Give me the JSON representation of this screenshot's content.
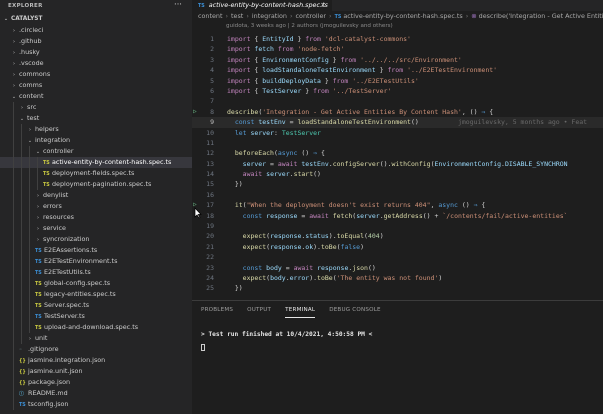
{
  "explorer": {
    "title": "EXPLORER",
    "more": "···",
    "items": [
      {
        "depth": 0,
        "chev": "⌄",
        "icon": "",
        "label": "CATALYST",
        "section": true
      },
      {
        "depth": 1,
        "chev": "›",
        "icon": "",
        "label": ".circleci"
      },
      {
        "depth": 1,
        "chev": "›",
        "icon": "",
        "label": ".github"
      },
      {
        "depth": 1,
        "chev": "›",
        "icon": "",
        "label": ".husky"
      },
      {
        "depth": 1,
        "chev": "›",
        "icon": "",
        "label": ".vscode"
      },
      {
        "depth": 1,
        "chev": "›",
        "icon": "",
        "label": "commons"
      },
      {
        "depth": 1,
        "chev": "›",
        "icon": "",
        "label": "comms"
      },
      {
        "depth": 1,
        "chev": "⌄",
        "icon": "",
        "label": "content"
      },
      {
        "depth": 2,
        "chev": "›",
        "icon": "",
        "label": "src"
      },
      {
        "depth": 2,
        "chev": "⌄",
        "icon": "",
        "label": "test"
      },
      {
        "depth": 3,
        "chev": "›",
        "icon": "",
        "label": "helpers"
      },
      {
        "depth": 3,
        "chev": "⌄",
        "icon": "",
        "label": "integration"
      },
      {
        "depth": 4,
        "chev": "⌄",
        "icon": "",
        "label": "controller"
      },
      {
        "depth": 5,
        "chev": "",
        "icon": "TS",
        "label": "active-entity-by-content-hash.spec.ts",
        "active": true,
        "kind": "ts-y"
      },
      {
        "depth": 5,
        "chev": "",
        "icon": "TS",
        "label": "deployment-fields.spec.ts",
        "kind": "ts-y"
      },
      {
        "depth": 5,
        "chev": "",
        "icon": "TS",
        "label": "deployment-pagination.spec.ts",
        "kind": "ts-y"
      },
      {
        "depth": 4,
        "chev": "›",
        "icon": "",
        "label": "denylist"
      },
      {
        "depth": 4,
        "chev": "›",
        "icon": "",
        "label": "errors"
      },
      {
        "depth": 4,
        "chev": "›",
        "icon": "",
        "label": "resources"
      },
      {
        "depth": 4,
        "chev": "›",
        "icon": "",
        "label": "service"
      },
      {
        "depth": 4,
        "chev": "›",
        "icon": "",
        "label": "syncronization"
      },
      {
        "depth": 4,
        "chev": "",
        "icon": "TS",
        "label": "E2EAssertions.ts",
        "kind": "ts"
      },
      {
        "depth": 4,
        "chev": "",
        "icon": "TS",
        "label": "E2ETestEnvironment.ts",
        "kind": "ts"
      },
      {
        "depth": 4,
        "chev": "",
        "icon": "TS",
        "label": "E2ETestUtils.ts",
        "kind": "ts"
      },
      {
        "depth": 4,
        "chev": "",
        "icon": "TS",
        "label": "global-config.spec.ts",
        "kind": "ts-y"
      },
      {
        "depth": 4,
        "chev": "",
        "icon": "TS",
        "label": "legacy-entities.spec.ts",
        "kind": "ts-y"
      },
      {
        "depth": 4,
        "chev": "",
        "icon": "TS",
        "label": "Server.spec.ts",
        "kind": "ts-y"
      },
      {
        "depth": 4,
        "chev": "",
        "icon": "TS",
        "label": "TestServer.ts",
        "kind": "ts"
      },
      {
        "depth": 4,
        "chev": "",
        "icon": "TS",
        "label": "upload-and-download.spec.ts",
        "kind": "ts-y"
      },
      {
        "depth": 3,
        "chev": "›",
        "icon": "",
        "label": "unit"
      },
      {
        "depth": 2,
        "chev": "",
        "icon": "◦",
        "label": ".gitignore",
        "kind": "ign"
      },
      {
        "depth": 2,
        "chev": "",
        "icon": "{}",
        "label": "jasmine.integration.json",
        "kind": "json"
      },
      {
        "depth": 2,
        "chev": "",
        "icon": "{}",
        "label": "jasmine.unit.json",
        "kind": "json"
      },
      {
        "depth": 2,
        "chev": "",
        "icon": "{}",
        "label": "package.json",
        "kind": "json"
      },
      {
        "depth": 2,
        "chev": "",
        "icon": "ⓘ",
        "label": "README.md",
        "kind": "md"
      },
      {
        "depth": 2,
        "chev": "",
        "icon": "TS",
        "label": "tsconfig.json",
        "kind": "ts"
      }
    ]
  },
  "tab": {
    "icon": "TS",
    "label": "active-entity-by-content-hash.spec.ts",
    "close": "×"
  },
  "breadcrumb": [
    "content",
    "test",
    "integration",
    "controller",
    "active-entity-by-content-hash.spec.ts",
    "describe('Integration - Get Active Entities B"
  ],
  "blame_header": "guidota, 3 weeks ago | 2 authors (jmoguilevsky and others)",
  "inline_blame": "jmoguilevsky, 5 months ago • Feat",
  "code": {
    "current_line": 9,
    "run_gutter_lines": [
      8,
      17
    ],
    "lines": [
      {
        "n": 1,
        "tokens": [
          [
            "kw",
            "import"
          ],
          [
            "pl",
            " { "
          ],
          [
            "var",
            "EntityId"
          ],
          [
            "pl",
            " } "
          ],
          [
            "kw",
            "from"
          ],
          [
            "pl",
            " "
          ],
          [
            "str",
            "'dcl-catalyst-commons'"
          ]
        ]
      },
      {
        "n": 2,
        "tokens": [
          [
            "kw",
            "import"
          ],
          [
            "pl",
            " "
          ],
          [
            "var",
            "fetch"
          ],
          [
            "pl",
            " "
          ],
          [
            "kw",
            "from"
          ],
          [
            "pl",
            " "
          ],
          [
            "str",
            "'node-fetch'"
          ]
        ]
      },
      {
        "n": 3,
        "tokens": [
          [
            "kw",
            "import"
          ],
          [
            "pl",
            " { "
          ],
          [
            "var",
            "EnvironmentConfig"
          ],
          [
            "pl",
            " } "
          ],
          [
            "kw",
            "from"
          ],
          [
            "pl",
            " "
          ],
          [
            "str",
            "'../../../src/Environment'"
          ]
        ]
      },
      {
        "n": 4,
        "tokens": [
          [
            "kw",
            "import"
          ],
          [
            "pl",
            " { "
          ],
          [
            "var",
            "loadStandaloneTestEnvironment"
          ],
          [
            "pl",
            " } "
          ],
          [
            "kw",
            "from"
          ],
          [
            "pl",
            " "
          ],
          [
            "str",
            "'../E2ETestEnvironment'"
          ]
        ]
      },
      {
        "n": 5,
        "tokens": [
          [
            "kw",
            "import"
          ],
          [
            "pl",
            " { "
          ],
          [
            "var",
            "buildDeployData"
          ],
          [
            "pl",
            " } "
          ],
          [
            "kw",
            "from"
          ],
          [
            "pl",
            " "
          ],
          [
            "str",
            "'../E2ETestUtils'"
          ]
        ]
      },
      {
        "n": 6,
        "tokens": [
          [
            "kw",
            "import"
          ],
          [
            "pl",
            " { "
          ],
          [
            "var",
            "TestServer"
          ],
          [
            "pl",
            " } "
          ],
          [
            "kw",
            "from"
          ],
          [
            "pl",
            " "
          ],
          [
            "str",
            "'../TestServer'"
          ]
        ]
      },
      {
        "n": 7,
        "tokens": []
      },
      {
        "n": 8,
        "tokens": [
          [
            "fn",
            "describe"
          ],
          [
            "pl",
            "("
          ],
          [
            "str",
            "'Integration - Get Active Entities By Content Hash'"
          ],
          [
            "pl",
            ", () "
          ],
          [
            "kb",
            "⇒"
          ],
          [
            "pl",
            " {"
          ]
        ]
      },
      {
        "n": 9,
        "tokens": [
          [
            "pl",
            "  "
          ],
          [
            "kb",
            "const"
          ],
          [
            "pl",
            " "
          ],
          [
            "var",
            "testEnv"
          ],
          [
            "pl",
            " = "
          ],
          [
            "fn",
            "loadStandaloneTestEnvironment"
          ],
          [
            "pl",
            "()"
          ]
        ],
        "blame": true
      },
      {
        "n": 10,
        "tokens": [
          [
            "pl",
            "  "
          ],
          [
            "kb",
            "let"
          ],
          [
            "pl",
            " "
          ],
          [
            "var",
            "server"
          ],
          [
            "pl",
            ": "
          ],
          [
            "typ",
            "TestServer"
          ]
        ]
      },
      {
        "n": 11,
        "tokens": []
      },
      {
        "n": 12,
        "tokens": [
          [
            "pl",
            "  "
          ],
          [
            "fn",
            "beforeEach"
          ],
          [
            "pl",
            "("
          ],
          [
            "kb",
            "async"
          ],
          [
            "pl",
            " () "
          ],
          [
            "kb",
            "⇒"
          ],
          [
            "pl",
            " {"
          ]
        ]
      },
      {
        "n": 13,
        "tokens": [
          [
            "pl",
            "    "
          ],
          [
            "var",
            "server"
          ],
          [
            "pl",
            " = "
          ],
          [
            "kw",
            "await"
          ],
          [
            "pl",
            " "
          ],
          [
            "var",
            "testEnv"
          ],
          [
            "pl",
            "."
          ],
          [
            "fn",
            "configServer"
          ],
          [
            "pl",
            "()."
          ],
          [
            "fn",
            "withConfig"
          ],
          [
            "pl",
            "("
          ],
          [
            "var",
            "EnvironmentConfig"
          ],
          [
            "pl",
            "."
          ],
          [
            "var",
            "DISABLE_SYNCHRON"
          ]
        ]
      },
      {
        "n": 14,
        "tokens": [
          [
            "pl",
            "    "
          ],
          [
            "kw",
            "await"
          ],
          [
            "pl",
            " "
          ],
          [
            "var",
            "server"
          ],
          [
            "pl",
            "."
          ],
          [
            "fn",
            "start"
          ],
          [
            "pl",
            "()"
          ]
        ]
      },
      {
        "n": 15,
        "tokens": [
          [
            "pl",
            "  })"
          ]
        ]
      },
      {
        "n": 16,
        "tokens": []
      },
      {
        "n": 17,
        "tokens": [
          [
            "pl",
            "  "
          ],
          [
            "fn",
            "it"
          ],
          [
            "pl",
            "("
          ],
          [
            "str",
            "\"When the deployment doesn't exist returns 404\""
          ],
          [
            "pl",
            ", "
          ],
          [
            "kb",
            "async"
          ],
          [
            "pl",
            " () "
          ],
          [
            "kb",
            "⇒"
          ],
          [
            "pl",
            " {"
          ]
        ]
      },
      {
        "n": 18,
        "tokens": [
          [
            "pl",
            "    "
          ],
          [
            "kb",
            "const"
          ],
          [
            "pl",
            " "
          ],
          [
            "var",
            "response"
          ],
          [
            "pl",
            " = "
          ],
          [
            "kw",
            "await"
          ],
          [
            "pl",
            " "
          ],
          [
            "fn",
            "fetch"
          ],
          [
            "pl",
            "("
          ],
          [
            "var",
            "server"
          ],
          [
            "pl",
            "."
          ],
          [
            "fn",
            "getAddress"
          ],
          [
            "pl",
            "() + "
          ],
          [
            "str",
            "`/contents/fail/active-entities`"
          ]
        ]
      },
      {
        "n": 19,
        "tokens": []
      },
      {
        "n": 20,
        "tokens": [
          [
            "pl",
            "    "
          ],
          [
            "fn",
            "expect"
          ],
          [
            "pl",
            "("
          ],
          [
            "var",
            "response"
          ],
          [
            "pl",
            "."
          ],
          [
            "var",
            "status"
          ],
          [
            "pl",
            ")."
          ],
          [
            "fn",
            "toEqual"
          ],
          [
            "pl",
            "("
          ],
          [
            "num",
            "404"
          ],
          [
            "pl",
            ")"
          ]
        ]
      },
      {
        "n": 21,
        "tokens": [
          [
            "pl",
            "    "
          ],
          [
            "fn",
            "expect"
          ],
          [
            "pl",
            "("
          ],
          [
            "var",
            "response"
          ],
          [
            "pl",
            "."
          ],
          [
            "var",
            "ok"
          ],
          [
            "pl",
            ")."
          ],
          [
            "fn",
            "toBe"
          ],
          [
            "pl",
            "("
          ],
          [
            "kb",
            "false"
          ],
          [
            "pl",
            ")"
          ]
        ]
      },
      {
        "n": 22,
        "tokens": []
      },
      {
        "n": 23,
        "tokens": [
          [
            "pl",
            "    "
          ],
          [
            "kb",
            "const"
          ],
          [
            "pl",
            " "
          ],
          [
            "var",
            "body"
          ],
          [
            "pl",
            " = "
          ],
          [
            "kw",
            "await"
          ],
          [
            "pl",
            " "
          ],
          [
            "var",
            "response"
          ],
          [
            "pl",
            "."
          ],
          [
            "fn",
            "json"
          ],
          [
            "pl",
            "()"
          ]
        ]
      },
      {
        "n": 24,
        "tokens": [
          [
            "pl",
            "    "
          ],
          [
            "fn",
            "expect"
          ],
          [
            "pl",
            "("
          ],
          [
            "var",
            "body"
          ],
          [
            "pl",
            "."
          ],
          [
            "var",
            "error"
          ],
          [
            "pl",
            ")."
          ],
          [
            "fn",
            "toBe"
          ],
          [
            "pl",
            "("
          ],
          [
            "str",
            "'The entity was not found'"
          ],
          [
            "pl",
            ")"
          ]
        ]
      },
      {
        "n": 25,
        "tokens": [
          [
            "pl",
            "  })"
          ]
        ]
      }
    ]
  },
  "panel": {
    "tabs": [
      {
        "label": "PROBLEMS",
        "active": false
      },
      {
        "label": "OUTPUT",
        "active": false
      },
      {
        "label": "TERMINAL",
        "active": true
      },
      {
        "label": "DEBUG CONSOLE",
        "active": false
      }
    ],
    "terminal_line": "> Test run finished at 10/4/2021, 4:50:58 PM <"
  }
}
